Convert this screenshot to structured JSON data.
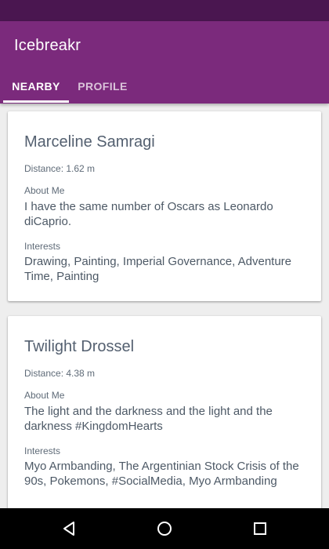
{
  "app": {
    "title": "Icebreakr"
  },
  "tabs": [
    {
      "label": "NEARBY",
      "selected": true
    },
    {
      "label": "PROFILE",
      "selected": false
    }
  ],
  "cards": [
    {
      "name": "Marceline Samragi",
      "distance": "Distance: 1.62 m",
      "about_label": "About Me",
      "about_text": "I have the same number of Oscars as Leonardo diCaprio.",
      "interests_label": "Interests",
      "interests_text": "Drawing, Painting, Imperial Governance, Adventure Time, Painting"
    },
    {
      "name": "Twilight Drossel",
      "distance": "Distance: 4.38 m",
      "about_label": "About Me",
      "about_text": "The light and the darkness and the light and the darkness #KingdomHearts",
      "interests_label": "Interests",
      "interests_text": "Myo Armbanding, The Argentinian Stock Crisis of the 90s, Pokemons, #SocialMedia, Myo Armbanding"
    }
  ],
  "navigation": {
    "icons": [
      "back-icon",
      "home-icon",
      "recent-apps-icon"
    ]
  },
  "colors": {
    "status_bar": "#4a1650",
    "app_bar": "#7b2a7c",
    "background": "#eeeeee",
    "card": "#ffffff",
    "text": "#546070",
    "nav_bar": "#000000"
  }
}
